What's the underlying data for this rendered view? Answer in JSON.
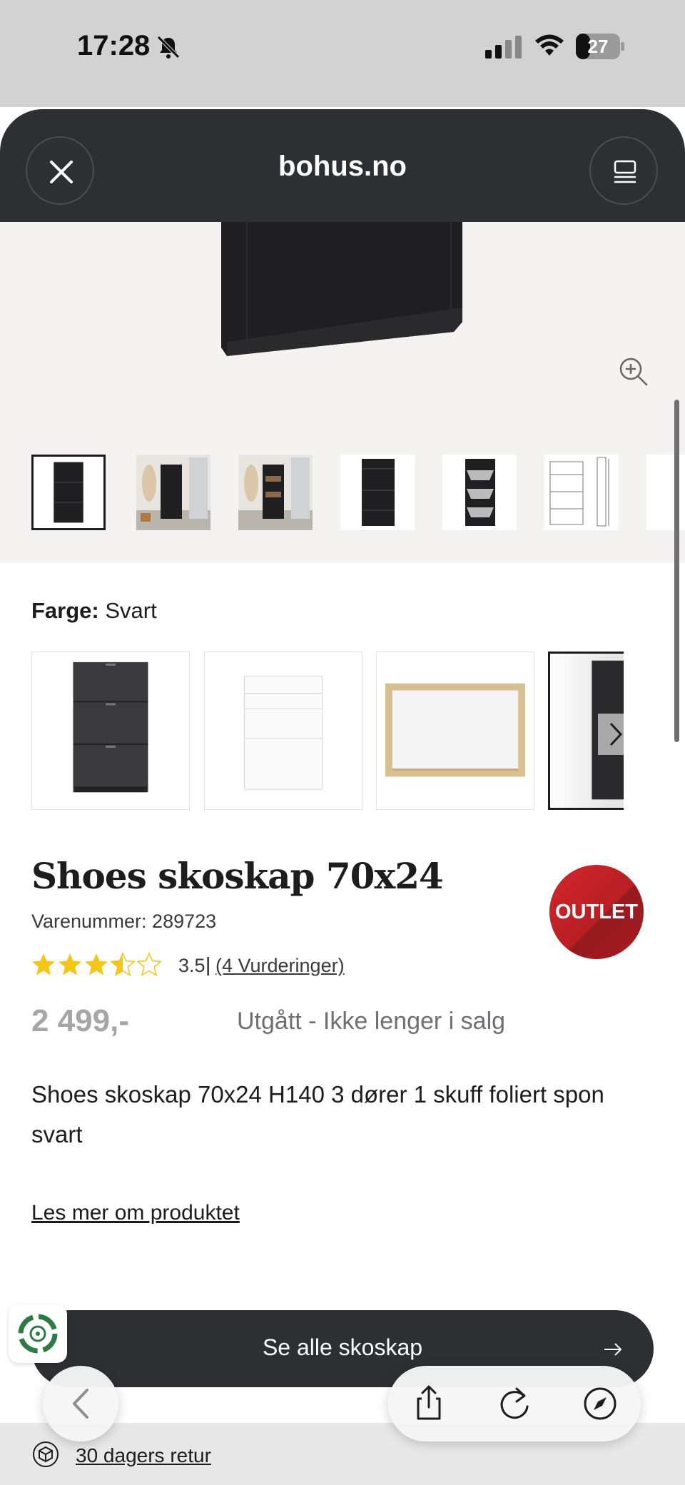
{
  "status_bar": {
    "time": "17:28",
    "battery": "27"
  },
  "browser": {
    "site": "bohus.no"
  },
  "product": {
    "color_label": "Farge:",
    "color_value": "Svart",
    "title": "Shoes skoskap 70x24",
    "sku": "Varenummer: 289723",
    "badge": "OUTLET",
    "rating_value": "3.5",
    "rating_separator": "|",
    "reviews_link": "(4 Vurderinger)",
    "rating_stars": 3.5,
    "price": "2 499,-",
    "status": "Utgått - Ikke lenger i salg",
    "description": "Shoes skoskap 70x24 H140 3 dører 1 skuff foliert spon svart",
    "read_more": "Les mer om produktet"
  },
  "cta": {
    "label": "Se alle skoskap"
  },
  "footer": {
    "return_text": "30 dagers retur"
  },
  "colors": {
    "header_bg": "#2e2f33",
    "badge": "#c8232a",
    "accent_star": "#f5c518"
  },
  "icons": [
    "close-icon",
    "tabs-icon",
    "zoom-in-icon",
    "chevron-right-icon",
    "arrow-right-icon",
    "back-icon",
    "share-icon",
    "reload-icon",
    "compass-icon",
    "return-box-icon",
    "recycle-icon"
  ]
}
